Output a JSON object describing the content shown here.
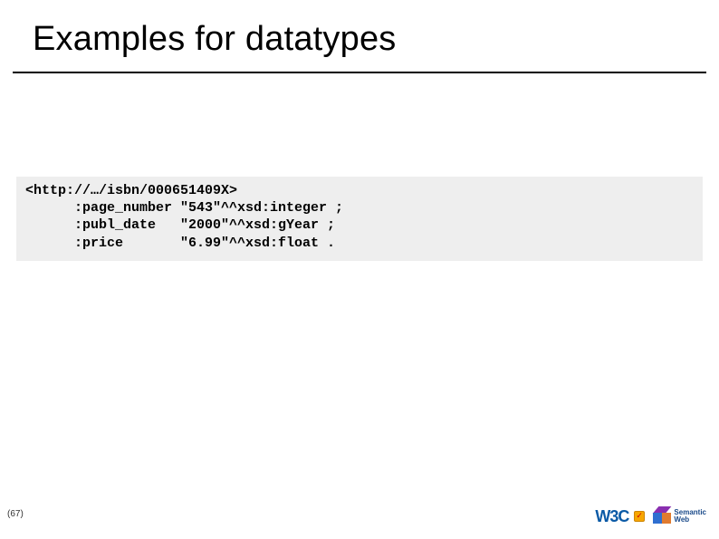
{
  "slide": {
    "title": "Examples for datatypes",
    "code_block": "<http://…/isbn/000651409X>\n      :page_number \"543\"^^xsd:integer ;\n      :publ_date   \"2000\"^^xsd:gYear ;\n      :price       \"6.99\"^^xsd:float .",
    "page_number": "(67)"
  },
  "logos": {
    "w3c_label": "W3C",
    "semantic_web_line1": "Semantic",
    "semantic_web_line2": "Web"
  }
}
